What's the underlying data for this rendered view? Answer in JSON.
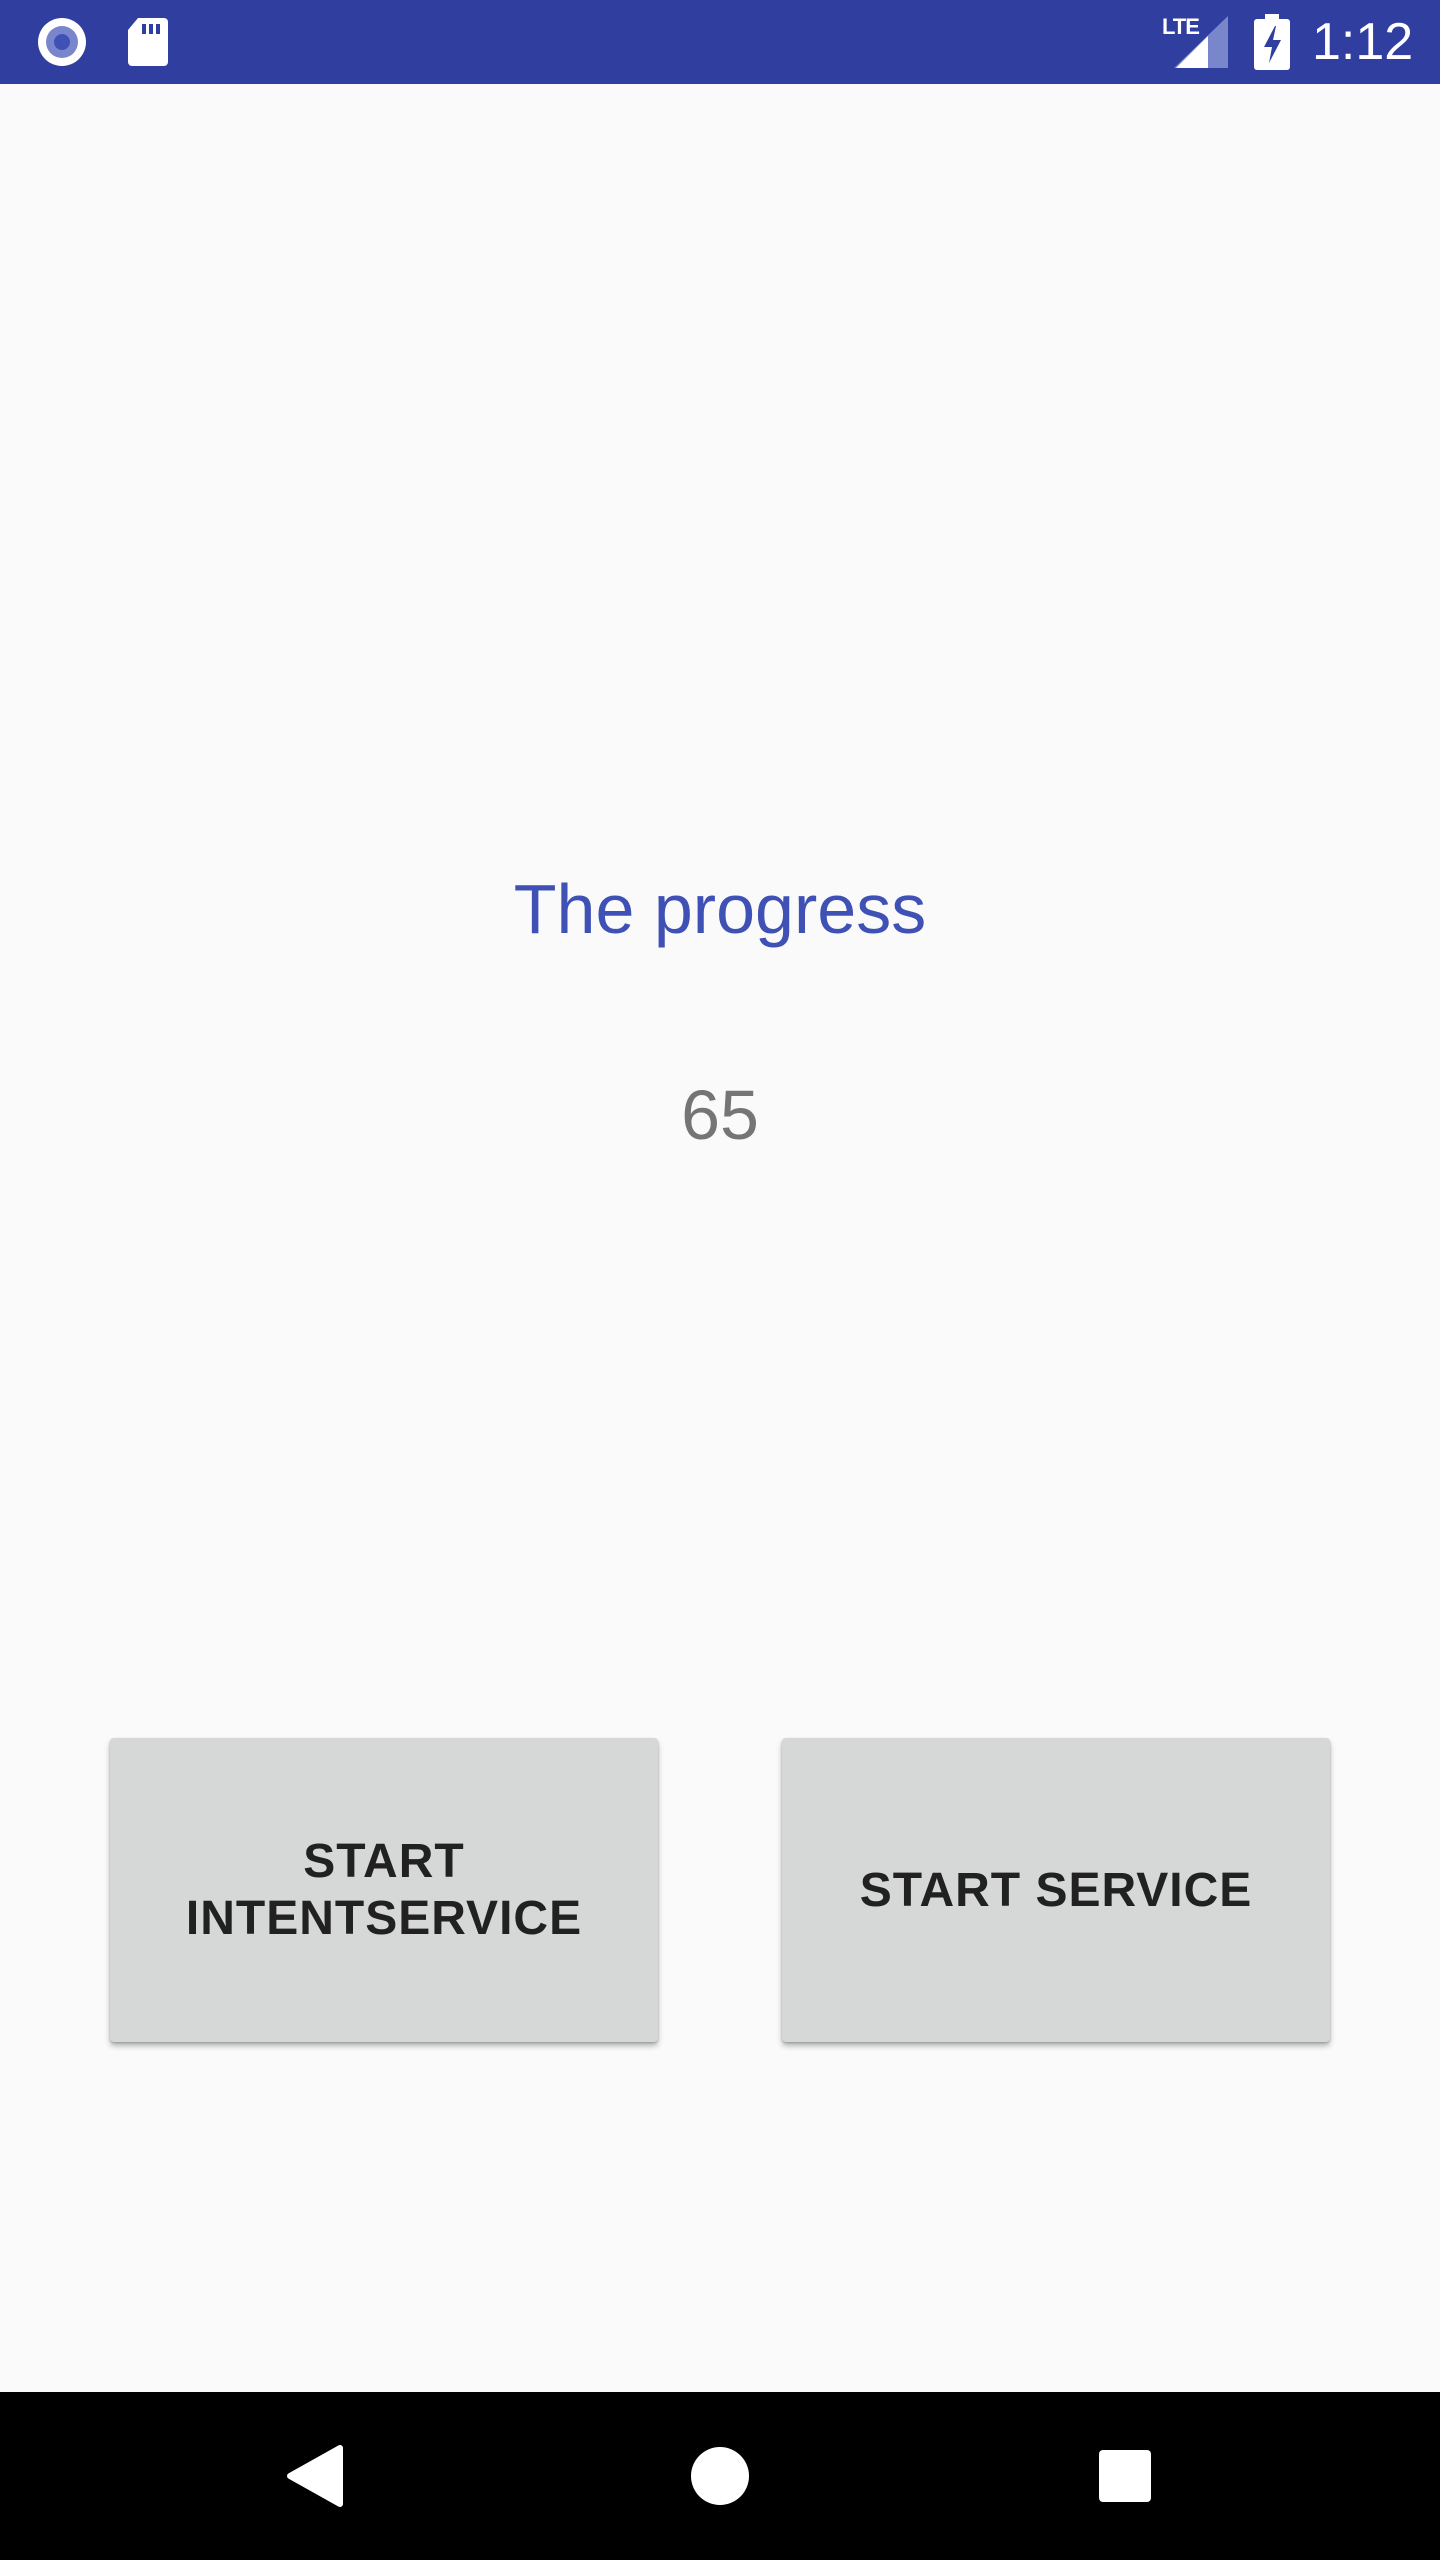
{
  "status_bar": {
    "network_label": "LTE",
    "time": "1:12",
    "icons": [
      "radio-icon",
      "sd-card-icon",
      "lte-signal-icon",
      "battery-charging-icon"
    ],
    "background_color": "#303f9f"
  },
  "main": {
    "title": "The progress",
    "progress_value": "65",
    "title_color": "#3f51b5",
    "value_color": "#757575"
  },
  "buttons": {
    "start_intentservice_label": "START INTENTSERVICE",
    "start_service_label": "START SERVICE"
  },
  "nav_bar": {
    "icons": [
      "back-icon",
      "home-icon",
      "recents-icon"
    ]
  }
}
